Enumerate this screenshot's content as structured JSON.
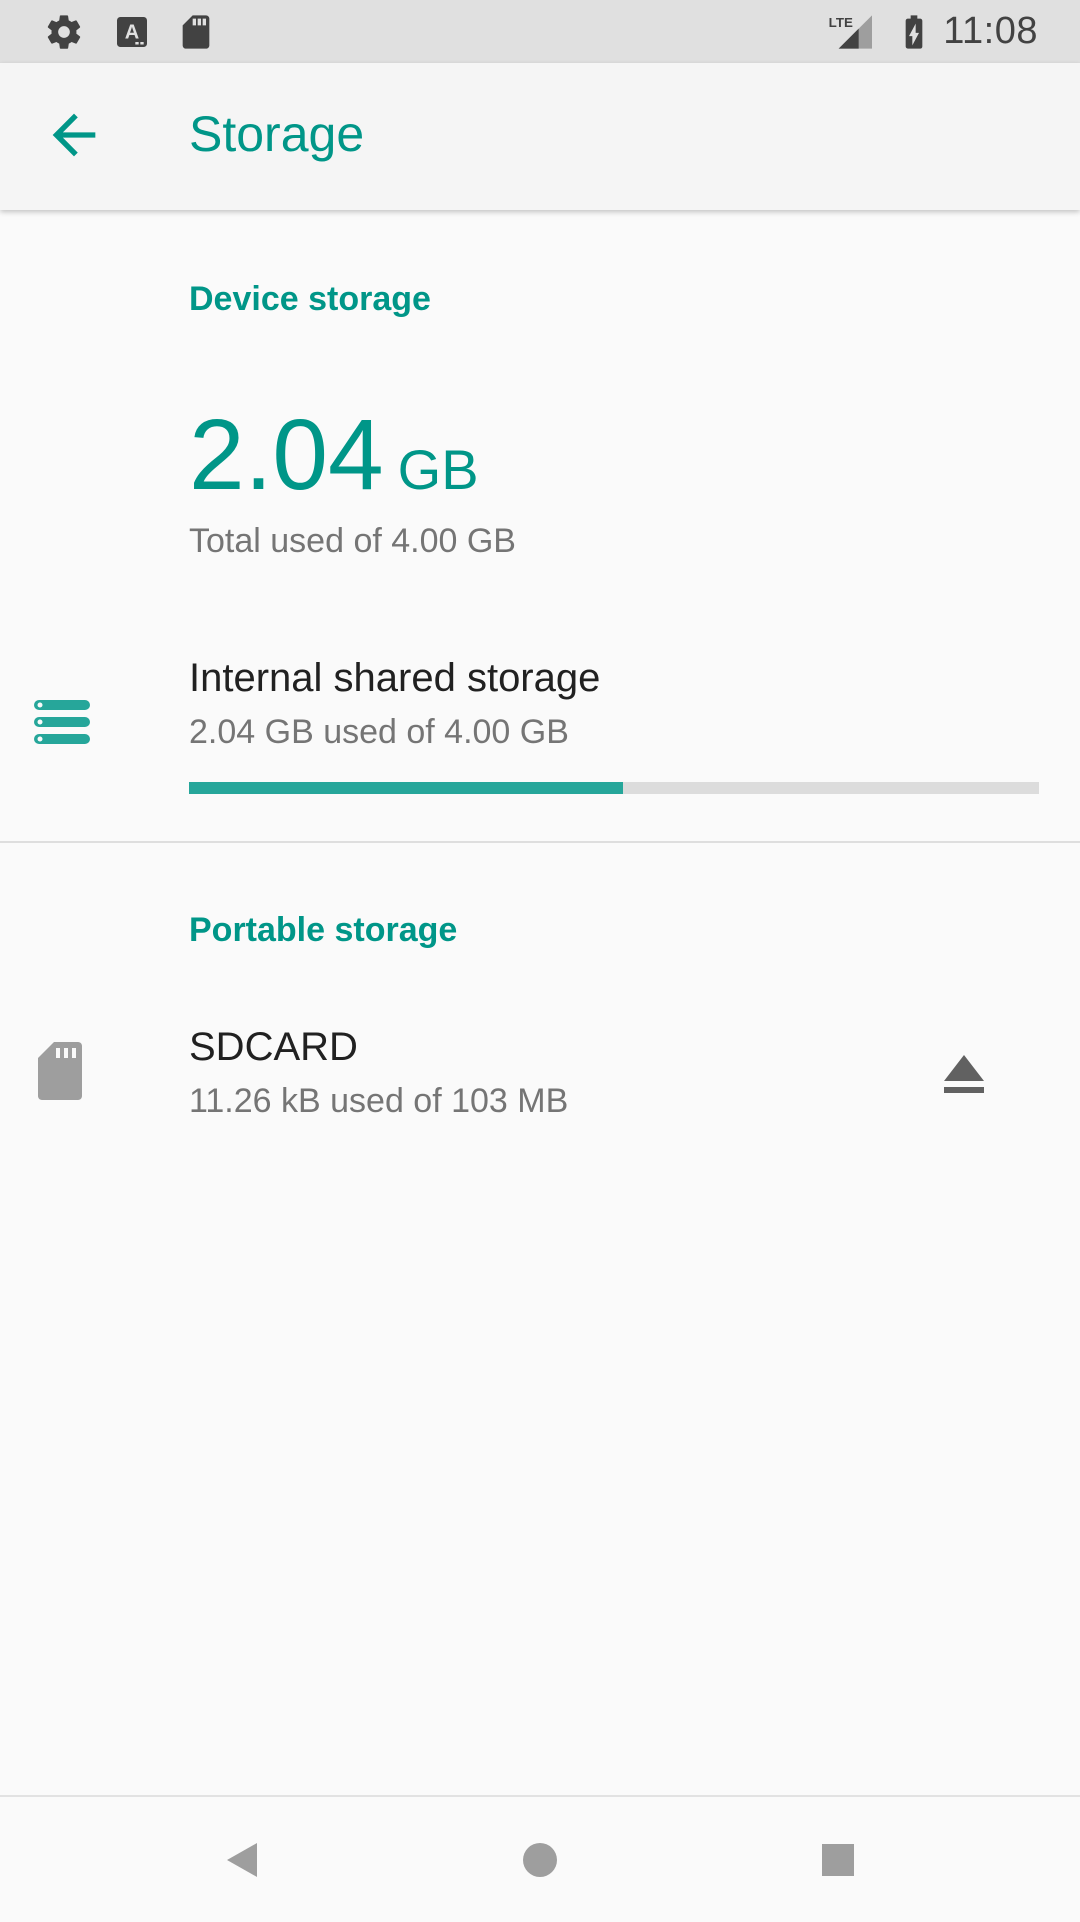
{
  "status_bar": {
    "time": "11:08",
    "icons": [
      "gear-icon",
      "text-a-icon",
      "sd-card-icon",
      "lte-signal-icon",
      "battery-charging-icon"
    ],
    "network_label": "LTE"
  },
  "app_bar": {
    "title": "Storage",
    "back_icon": "arrow-back-icon"
  },
  "device_storage": {
    "header": "Device storage",
    "used_value": "2.04",
    "used_unit": "GB",
    "total_text": "Total used of 4.00 GB",
    "internal": {
      "icon": "storage-icon",
      "title": "Internal shared storage",
      "summary": "2.04 GB used of 4.00 GB",
      "used_fraction": 0.51
    }
  },
  "portable_storage": {
    "header": "Portable storage",
    "sdcard": {
      "icon": "sd-card-icon",
      "title": "SDCARD",
      "summary": "11.26 kB used of 103 MB",
      "action_icon": "eject-icon"
    }
  },
  "nav_bar": {
    "buttons": [
      "back-triangle-icon",
      "home-circle-icon",
      "recents-square-icon"
    ]
  },
  "colors": {
    "accent": "#009688",
    "progress": "#26a69a",
    "status_bar": "#e0e0e0",
    "app_bar": "#f5f5f5"
  }
}
